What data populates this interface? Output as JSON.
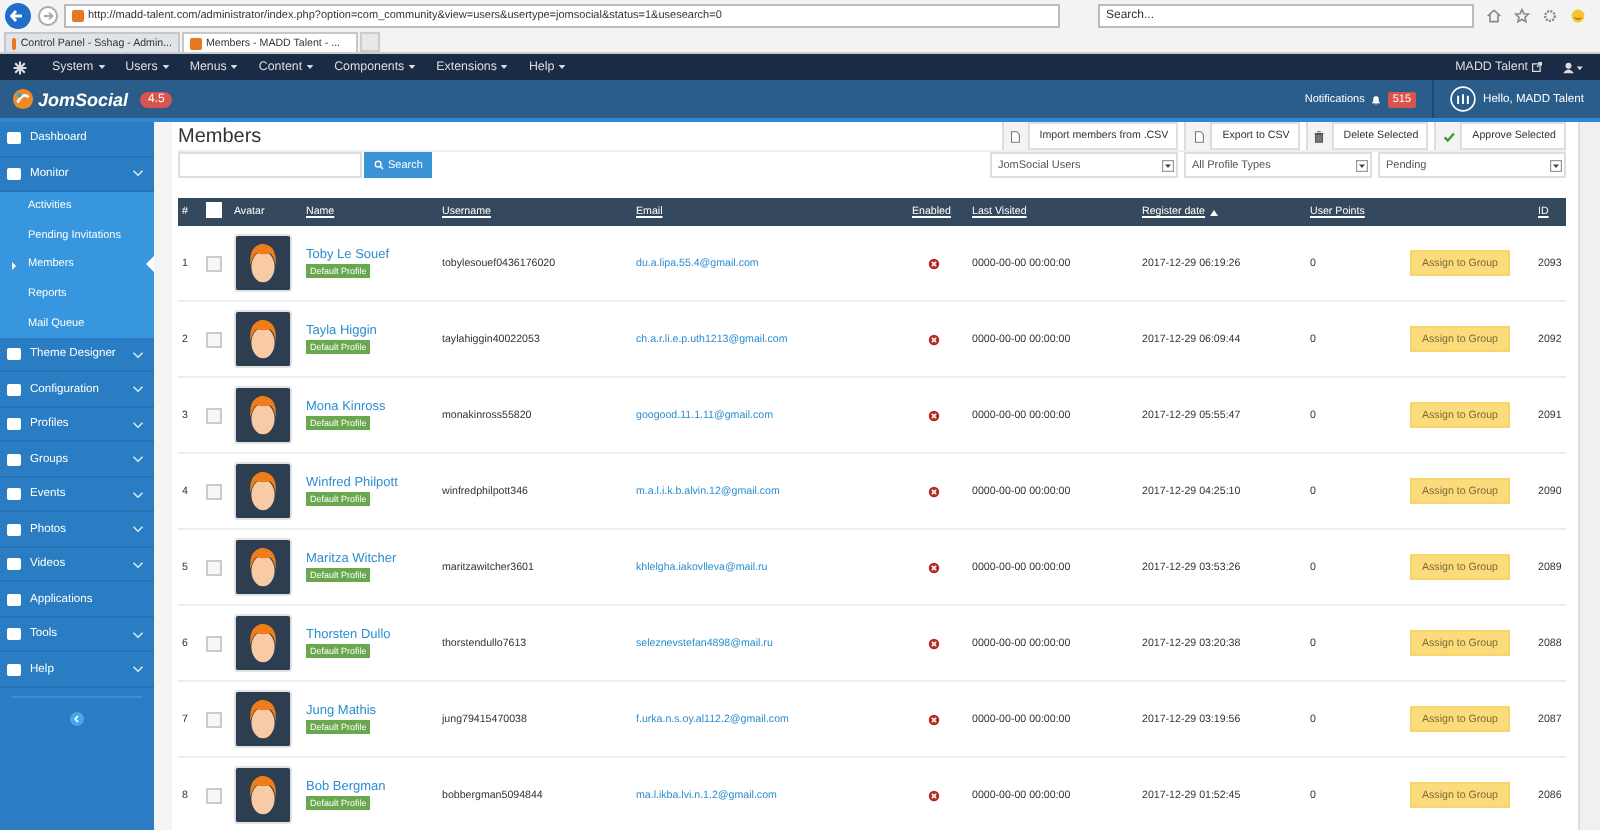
{
  "browser": {
    "address": "http://madd-talent.com/administrator/index.php?option=com_community&view=users&usertype=jomsocial&status=1&usesearch=0",
    "search_placeholder": "Search...",
    "tabs": [
      {
        "label": "Control Panel - Sshag - Admin...",
        "selected": false
      },
      {
        "label": "Members - MADD Talent - ...",
        "selected": true
      }
    ]
  },
  "admin_menu": {
    "items": [
      "System",
      "Users",
      "Menus",
      "Content",
      "Components",
      "Extensions",
      "Help"
    ],
    "site_link": "MADD Talent"
  },
  "header": {
    "logo": "JomSocial",
    "version": "4.5",
    "notifications_label": "Notifications",
    "notifications_count": "515",
    "greeting": "Hello, MADD Talent"
  },
  "sidebar": {
    "items": [
      {
        "label": "Dashboard",
        "kind": "link"
      },
      {
        "label": "Monitor",
        "kind": "menu",
        "children": [
          {
            "label": "Activities",
            "selected": false
          },
          {
            "label": "Pending Invitations",
            "selected": false
          },
          {
            "label": "Members",
            "selected": true
          },
          {
            "label": "Reports",
            "selected": false
          },
          {
            "label": "Mail Queue",
            "selected": false
          }
        ]
      },
      {
        "label": "Theme Designer",
        "kind": "menu"
      },
      {
        "label": "Configuration",
        "kind": "menu"
      },
      {
        "label": "Profiles",
        "kind": "menu"
      },
      {
        "label": "Groups",
        "kind": "menu"
      },
      {
        "label": "Events",
        "kind": "menu"
      },
      {
        "label": "Photos",
        "kind": "menu"
      },
      {
        "label": "Videos",
        "kind": "menu"
      },
      {
        "label": "Applications",
        "kind": "link"
      },
      {
        "label": "Tools",
        "kind": "menu"
      },
      {
        "label": "Help",
        "kind": "menu"
      }
    ]
  },
  "page": {
    "title": "Members",
    "toolbar": [
      {
        "label": "Import members from .CSV",
        "kind": "file"
      },
      {
        "label": "Export to CSV",
        "kind": "file"
      },
      {
        "label": "Delete Selected",
        "kind": "trash"
      },
      {
        "label": "Approve Selected",
        "kind": "check"
      }
    ],
    "search": {
      "button": "Search"
    },
    "filters": [
      "JomSocial Users",
      "All Profile Types",
      "Pending"
    ]
  },
  "table": {
    "columns": [
      {
        "kind": "text",
        "label": "#"
      },
      {
        "kind": "checkbox",
        "checked": false
      },
      {
        "kind": "text",
        "label": "Avatar"
      },
      {
        "kind": "link",
        "label": "Name",
        "sorted": false
      },
      {
        "kind": "link",
        "label": "Username",
        "sorted": false
      },
      {
        "kind": "link",
        "label": "Email",
        "sorted": false
      },
      {
        "kind": "link",
        "label": "Enabled",
        "sorted": false
      },
      {
        "kind": "link",
        "label": "Last Visited",
        "sorted": false
      },
      {
        "kind": "link",
        "label": "Register date",
        "sorted": true
      },
      {
        "kind": "link",
        "label": "User Points",
        "sorted": false
      },
      {
        "kind": "blank"
      },
      {
        "kind": "link",
        "label": "ID",
        "sorted": false
      }
    ],
    "rows": [
      {
        "number": "1",
        "checked": false,
        "name": "Toby Le Souef",
        "badge": "Default Profile",
        "username": "tobylesouef0436176020",
        "email": "du.a.lipa.55.4@gmail.com",
        "enabled": false,
        "last_visited": "0000-00-00 00:00:00",
        "register_date": "2017-12-29 06:19:26",
        "points": "0",
        "action": "Assign to Group",
        "id": "2093"
      },
      {
        "number": "2",
        "checked": false,
        "name": "Tayla Higgin",
        "badge": "Default Profile",
        "username": "taylahiggin40022053",
        "email": "ch.a.r.li.e.p.uth1213@gmail.com",
        "enabled": false,
        "last_visited": "0000-00-00 00:00:00",
        "register_date": "2017-12-29 06:09:44",
        "points": "0",
        "action": "Assign to Group",
        "id": "2092"
      },
      {
        "number": "3",
        "checked": false,
        "name": "Mona Kinross",
        "badge": "Default Profile",
        "username": "monakinross55820",
        "email": "googood.11.1.11@gmail.com",
        "enabled": false,
        "last_visited": "0000-00-00 00:00:00",
        "register_date": "2017-12-29 05:55:47",
        "points": "0",
        "action": "Assign to Group",
        "id": "2091"
      },
      {
        "number": "4",
        "checked": false,
        "name": "Winfred Philpott",
        "badge": "Default Profile",
        "username": "winfredphilpott346",
        "email": "m.a.l.i.k.b.alvin.12@gmail.com",
        "enabled": false,
        "last_visited": "0000-00-00 00:00:00",
        "register_date": "2017-12-29 04:25:10",
        "points": "0",
        "action": "Assign to Group",
        "id": "2090"
      },
      {
        "number": "5",
        "checked": false,
        "name": "Maritza Witcher",
        "badge": "Default Profile",
        "username": "maritzawitcher3601",
        "email": "khlelgha.iakovlleva@mail.ru",
        "enabled": false,
        "last_visited": "0000-00-00 00:00:00",
        "register_date": "2017-12-29 03:53:26",
        "points": "0",
        "action": "Assign to Group",
        "id": "2089"
      },
      {
        "number": "6",
        "checked": false,
        "name": "Thorsten Dullo",
        "badge": "Default Profile",
        "username": "thorstendullo7613",
        "email": "seleznevstefan4898@mail.ru",
        "enabled": false,
        "last_visited": "0000-00-00 00:00:00",
        "register_date": "2017-12-29 03:20:38",
        "points": "0",
        "action": "Assign to Group",
        "id": "2088"
      },
      {
        "number": "7",
        "checked": false,
        "name": "Jung Mathis",
        "badge": "Default Profile",
        "username": "jung79415470038",
        "email": "f.urka.n.s.oy.al112.2@gmail.com",
        "enabled": false,
        "last_visited": "0000-00-00 00:00:00",
        "register_date": "2017-12-29 03:19:56",
        "points": "0",
        "action": "Assign to Group",
        "id": "2087"
      },
      {
        "number": "8",
        "checked": false,
        "name": "Bob Bergman",
        "badge": "Default Profile",
        "username": "bobbergman5094844",
        "email": "ma.l.ikba.lvi.n.1.2@gmail.com",
        "enabled": false,
        "last_visited": "0000-00-00 00:00:00",
        "register_date": "2017-12-29 01:52:45",
        "points": "0",
        "action": "Assign to Group",
        "id": "2086"
      }
    ]
  }
}
